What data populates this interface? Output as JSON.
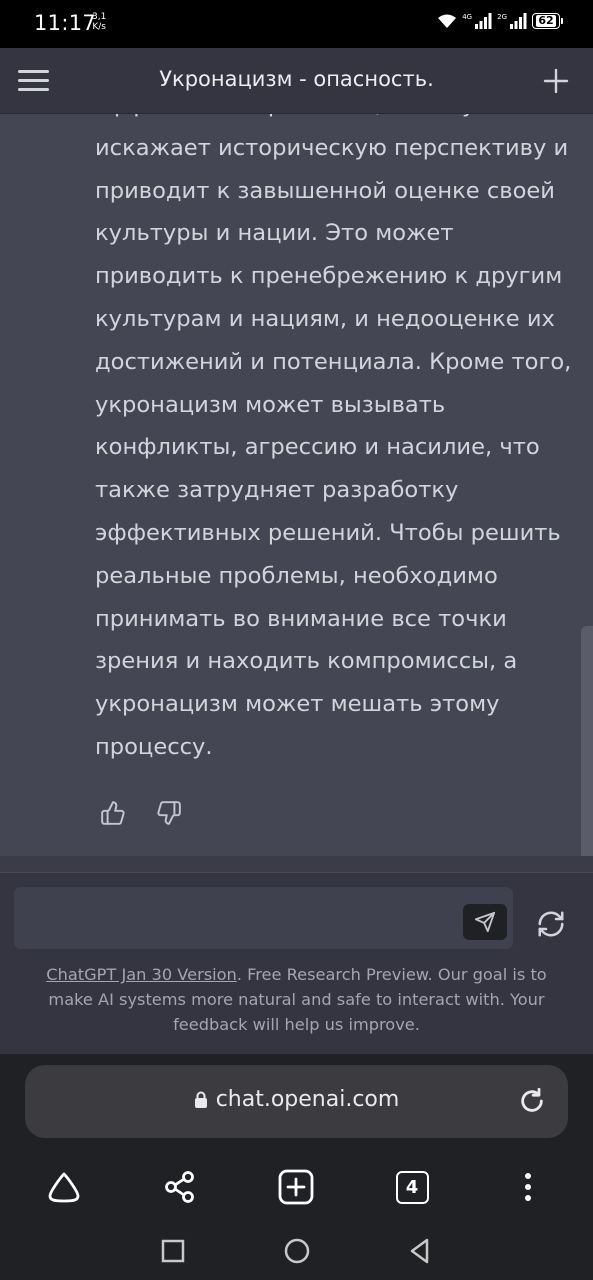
{
  "status_bar": {
    "time": "11:17",
    "speed_value": "3,1",
    "speed_unit": "K/s",
    "network_1": "4G",
    "network_2": "2G",
    "battery": "62"
  },
  "header": {
    "title": "Укронацизм - опасность.",
    "menu_icon": "hamburger-menu-icon",
    "new_chat_icon": "plus-icon"
  },
  "message": {
    "lines": [
      "эффективных решений, потому что он",
      "искажает историческую перспективу и",
      "приводит к завышенной оценке своей",
      "культуры и нации. Это может",
      "приводить к пренебрежению к другим",
      "культурам и нациям, и недооценке их",
      "достижений и потенциала. Кроме того,",
      "укронацизм может вызывать",
      "конфликты, агрессию и насилие, что",
      "также затрудняет разработку",
      "эффективных решений. Чтобы решить",
      "реальные проблемы, необходимо",
      "принимать во внимание все точки",
      "зрения и находить компромиссы, а",
      "укронацизм может мешать этому",
      "процессу."
    ],
    "feedback_icons": [
      "thumbs-up-icon",
      "thumbs-down-icon"
    ]
  },
  "composer": {
    "input_value": "",
    "send_icon": "paper-plane-icon",
    "regenerate_icon": "refresh-icon"
  },
  "disclaimer": {
    "link": "ChatGPT Jan 30 Version",
    "text": ". Free Research Preview. Our goal is to make AI systems more natural and safe to interact with. Your feedback will help us improve."
  },
  "browser": {
    "url": "chat.openai.com",
    "tab_count": "4",
    "nav_icons": [
      "home-icon",
      "share-icon",
      "new-tab-icon",
      "tabs-icon",
      "more-icon"
    ]
  },
  "colors": {
    "header_bg": "#343541",
    "message_bg": "#444654",
    "text": "#d1d5db",
    "browser_bg": "#202124"
  }
}
